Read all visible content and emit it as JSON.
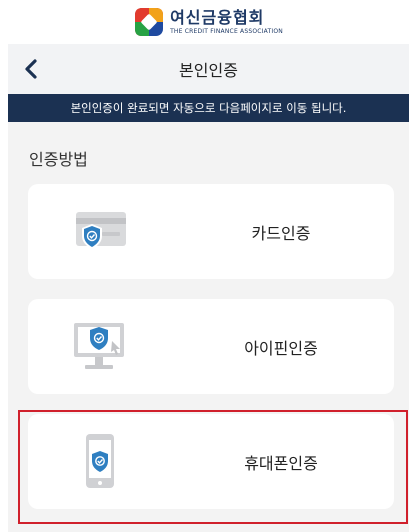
{
  "brand": {
    "name_ko": "여신금융협회",
    "name_en": "THE CREDIT FINANCE ASSOCIATION"
  },
  "header": {
    "title": "본인인증",
    "back_icon": "chevron-left-icon"
  },
  "notice": {
    "text": "본인인증이 완료되면 자동으로 다음페이지로 이동 됩니다."
  },
  "section": {
    "title": "인증방법"
  },
  "methods": [
    {
      "label": "카드인증",
      "icon": "credit-card-shield-icon"
    },
    {
      "label": "아이핀인증",
      "icon": "monitor-shield-icon"
    },
    {
      "label": "휴대폰인증",
      "icon": "phone-shield-icon",
      "selected": true
    }
  ],
  "colors": {
    "navy": "#1b3152",
    "shield_blue": "#2f7fc1",
    "highlight_red": "#d0202c",
    "background_gray": "#f3f3f3"
  }
}
